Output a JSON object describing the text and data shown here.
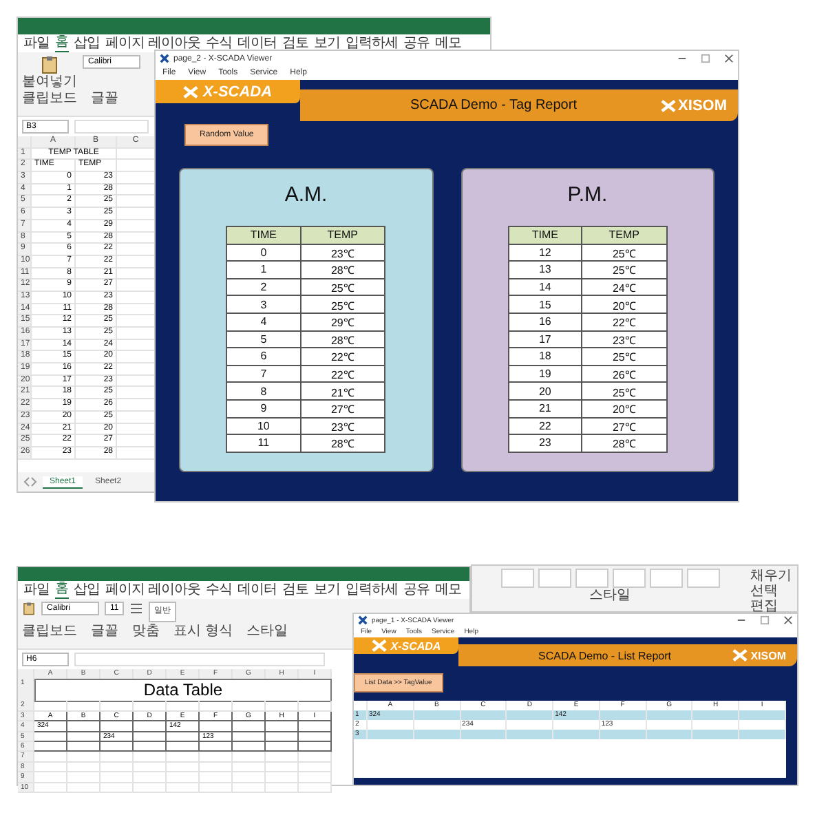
{
  "tag_report_screen": {
    "spreadsheet": {
      "menu": [
        {
          "label": "파일",
          "selected": false
        },
        {
          "label": "홈",
          "selected": true
        },
        {
          "label": "삽입",
          "selected": false
        },
        {
          "label": "페이지 레이아웃",
          "selected": false
        },
        {
          "label": "수식",
          "selected": false
        },
        {
          "label": "데이터",
          "selected": false
        },
        {
          "label": "검토",
          "selected": false
        },
        {
          "label": "보기",
          "selected": false
        }
      ],
      "menu_extras": [
        "입력하세",
        "공유",
        "메모"
      ],
      "paste_label": "붙여넣기",
      "font": "Calibri",
      "groups": [
        "클립보드",
        "글꼴"
      ],
      "cell_ref": "B3",
      "columns": [
        "A",
        "B",
        "C"
      ],
      "title_row": {
        "num": "1",
        "text": "TEMP TABLE"
      },
      "header_row": {
        "num": "2",
        "cells": [
          "TIME",
          "TEMP"
        ]
      },
      "rows": [
        {
          "num": "3",
          "cells": [
            "0",
            "23"
          ]
        },
        {
          "num": "4",
          "cells": [
            "1",
            "28"
          ]
        },
        {
          "num": "5",
          "cells": [
            "2",
            "25"
          ]
        },
        {
          "num": "6",
          "cells": [
            "3",
            "25"
          ]
        },
        {
          "num": "7",
          "cells": [
            "4",
            "29"
          ]
        },
        {
          "num": "8",
          "cells": [
            "5",
            "28"
          ]
        },
        {
          "num": "9",
          "cells": [
            "6",
            "22"
          ]
        },
        {
          "num": "10",
          "cells": [
            "7",
            "22"
          ]
        },
        {
          "num": "11",
          "cells": [
            "8",
            "21"
          ]
        },
        {
          "num": "12",
          "cells": [
            "9",
            "27"
          ]
        },
        {
          "num": "13",
          "cells": [
            "10",
            "23"
          ]
        },
        {
          "num": "14",
          "cells": [
            "11",
            "28"
          ]
        },
        {
          "num": "15",
          "cells": [
            "12",
            "25"
          ]
        },
        {
          "num": "16",
          "cells": [
            "13",
            "25"
          ]
        },
        {
          "num": "17",
          "cells": [
            "14",
            "24"
          ]
        },
        {
          "num": "18",
          "cells": [
            "15",
            "20"
          ]
        },
        {
          "num": "19",
          "cells": [
            "16",
            "22"
          ]
        },
        {
          "num": "20",
          "cells": [
            "17",
            "23"
          ]
        },
        {
          "num": "21",
          "cells": [
            "18",
            "25"
          ]
        },
        {
          "num": "22",
          "cells": [
            "19",
            "26"
          ]
        },
        {
          "num": "23",
          "cells": [
            "20",
            "25"
          ]
        },
        {
          "num": "24",
          "cells": [
            "21",
            "20"
          ]
        },
        {
          "num": "25",
          "cells": [
            "22",
            "27"
          ]
        },
        {
          "num": "26",
          "cells": [
            "23",
            "28"
          ]
        }
      ],
      "sheets": [
        {
          "label": "Sheet1",
          "selected": true
        },
        {
          "label": "Sheet2",
          "selected": false
        }
      ]
    },
    "viewer": {
      "title": "page_2 - X-SCADA Viewer",
      "menu": [
        "File",
        "View",
        "Tools",
        "Service",
        "Help"
      ],
      "logo": "X-SCADA",
      "heading": "SCADA Demo - Tag Report",
      "brand": "XISOM",
      "button": "Random Value",
      "panels": [
        {
          "title": "A.M.",
          "color": "#b6dde6",
          "columns": [
            "TIME",
            "TEMP"
          ],
          "rows": [
            [
              "0",
              "23℃"
            ],
            [
              "1",
              "28℃"
            ],
            [
              "2",
              "25℃"
            ],
            [
              "3",
              "25℃"
            ],
            [
              "4",
              "29℃"
            ],
            [
              "5",
              "28℃"
            ],
            [
              "6",
              "22℃"
            ],
            [
              "7",
              "22℃"
            ],
            [
              "8",
              "21℃"
            ],
            [
              "9",
              "27℃"
            ],
            [
              "10",
              "23℃"
            ],
            [
              "11",
              "28℃"
            ]
          ]
        },
        {
          "title": "P.M.",
          "color": "#cdbfda",
          "columns": [
            "TIME",
            "TEMP"
          ],
          "rows": [
            [
              "12",
              "25℃"
            ],
            [
              "13",
              "25℃"
            ],
            [
              "14",
              "24℃"
            ],
            [
              "15",
              "20℃"
            ],
            [
              "16",
              "22℃"
            ],
            [
              "17",
              "23℃"
            ],
            [
              "18",
              "25℃"
            ],
            [
              "19",
              "26℃"
            ],
            [
              "20",
              "25℃"
            ],
            [
              "21",
              "20℃"
            ],
            [
              "22",
              "27℃"
            ],
            [
              "23",
              "28℃"
            ]
          ]
        }
      ]
    }
  },
  "list_report_screen": {
    "spreadsheet": {
      "menu": [
        {
          "label": "파일",
          "selected": false
        },
        {
          "label": "홈",
          "selected": true
        },
        {
          "label": "삽입",
          "selected": false
        },
        {
          "label": "페이지 레이아웃",
          "selected": false
        },
        {
          "label": "수식",
          "selected": false
        },
        {
          "label": "데이터",
          "selected": false
        },
        {
          "label": "검토",
          "selected": false
        },
        {
          "label": "보기",
          "selected": false
        }
      ],
      "menu_extras": [
        "입력하세",
        "공유",
        "메모"
      ],
      "font": "Calibri",
      "font_size": "11",
      "number_format": "일반",
      "groups": [
        "클립보드",
        "글꼴",
        "맞춤",
        "표시 형식",
        "스타일"
      ],
      "cell_ref": "H6",
      "columns": [
        "A",
        "B",
        "C",
        "D",
        "E",
        "F",
        "G",
        "H",
        "I"
      ],
      "title_row": {
        "num": "1",
        "text": "Data Table"
      },
      "rows": [
        {
          "num": "2",
          "kind": "blank"
        },
        {
          "num": "3",
          "kind": "header",
          "cells": [
            "A",
            "B",
            "C",
            "D",
            "E",
            "F",
            "G",
            "H",
            "I"
          ]
        },
        {
          "num": "4",
          "kind": "table",
          "cells": [
            "324",
            null,
            null,
            null,
            "142"
          ]
        },
        {
          "num": "5",
          "kind": "table",
          "cells": [
            null,
            null,
            "234",
            null,
            null,
            "123"
          ]
        },
        {
          "num": "6",
          "kind": "table"
        },
        {
          "num": "7",
          "kind": "blank"
        },
        {
          "num": "8",
          "kind": "blank"
        },
        {
          "num": "9",
          "kind": "blank"
        },
        {
          "num": "10",
          "kind": "blank"
        }
      ]
    },
    "style_ribbon": {
      "group_label": "스타일",
      "commands": [
        "채우기",
        "선택"
      ],
      "edit_label": "편집"
    },
    "viewer": {
      "title": "page_1 - X-SCADA Viewer",
      "menu": [
        "File",
        "View",
        "Tools",
        "Service",
        "Help"
      ],
      "logo": "X-SCADA",
      "heading": "SCADA Demo - List Report",
      "brand": "XISOM",
      "button": "List Data >> TagValue",
      "grid": {
        "columns": [
          "A",
          "B",
          "C",
          "D",
          "E",
          "F",
          "G",
          "H",
          "I"
        ],
        "rows": [
          {
            "num": "1",
            "cells": [
              "324",
              null,
              null,
              null,
              "142"
            ]
          },
          {
            "num": "2",
            "cells": [
              null,
              null,
              "234",
              null,
              null,
              "123"
            ]
          },
          {
            "num": "3"
          }
        ]
      }
    }
  }
}
